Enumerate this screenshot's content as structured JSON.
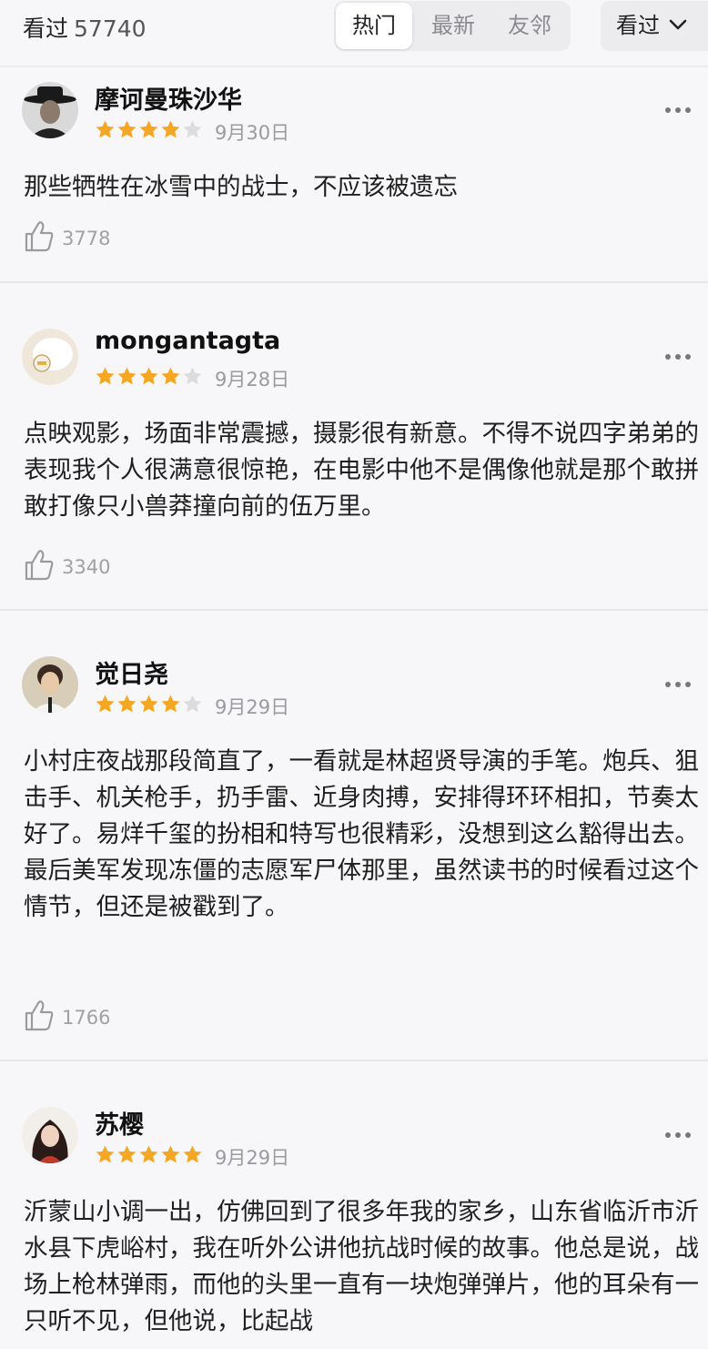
{
  "header": {
    "watched_label": "看过",
    "watched_count": "57740",
    "tabs": [
      "热门",
      "最新",
      "友邻"
    ],
    "sort_label": "看过"
  },
  "colors": {
    "star": "#f5a623",
    "star_empty": "#dcdcdc",
    "background": "#f7f7f9"
  },
  "comments": [
    {
      "user": "摩诃曼珠沙华",
      "rating": 4,
      "date": "9月30日",
      "text": "那些牺牲在冰雪中的战士，不应该被遗忘",
      "likes": "3778"
    },
    {
      "user": "mongantagta",
      "rating": 4,
      "date": "9月28日",
      "text": "点映观影，场面非常震撼，摄影很有新意。不得不说四字弟弟的表现我个人很满意很惊艳，在电影中他不是偶像他就是那个敢拼敢打像只小兽莽撞向前的伍万里。",
      "likes": "3340"
    },
    {
      "user": "觉日尧",
      "rating": 4,
      "date": "9月29日",
      "text": "小村庄夜战那段简直了，一看就是林超贤导演的手笔。炮兵、狙击手、机关枪手，扔手雷、近身肉搏，安排得环环相扣，节奏太好了。易烊千玺的扮相和特写也很精彩，没想到这么豁得出去。最后美军发现冻僵的志愿军尸体那里，虽然读书的时候看过这个情节，但还是被戳到了。",
      "likes": "1766"
    },
    {
      "user": "苏樱",
      "rating": 5,
      "date": "9月29日",
      "text": "沂蒙山小调一出，仿佛回到了很多年我的家乡，山东省临沂市沂水县下虎峪村，我在听外公讲他抗战时候的故事。他总是说，战场上枪林弹雨，而他的头里一直有一块炮弹弹片，他的耳朵有一只听不见，但他说，比起战",
      "likes": ""
    }
  ]
}
